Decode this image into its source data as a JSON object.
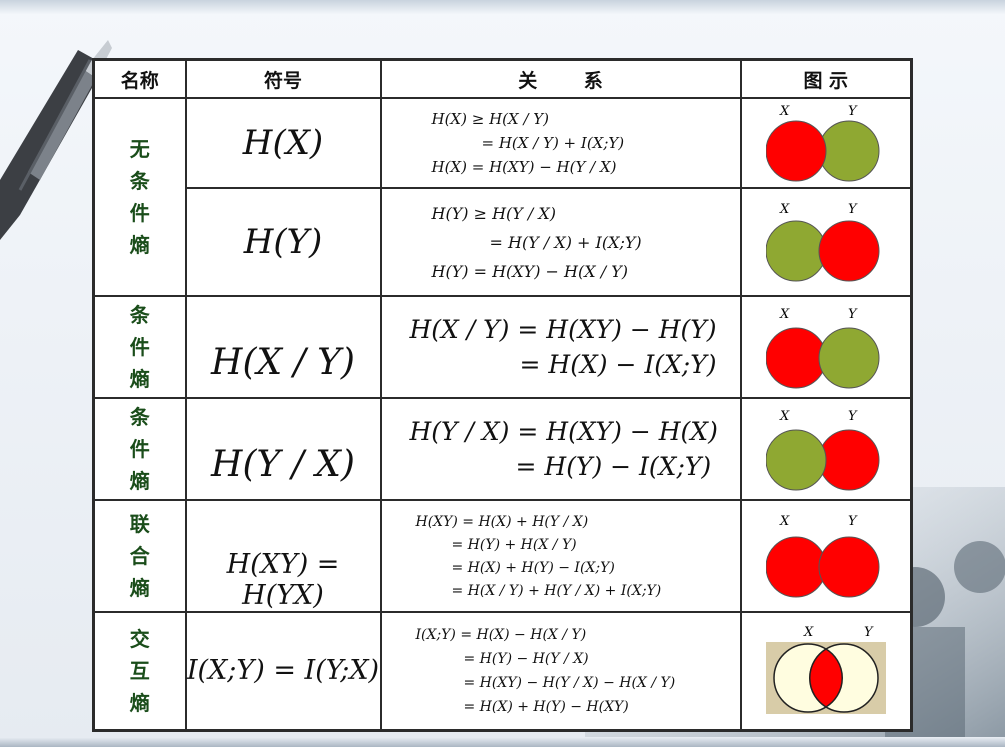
{
  "headers": {
    "name": "名称",
    "symbol": "符号",
    "relation": "关 系",
    "figure": "图 示"
  },
  "venn_labels": {
    "x": "X",
    "y": "Y"
  },
  "colors": {
    "red": "#ff0000",
    "green": "#8fa832",
    "cream": "#fffde0",
    "fig_bg": "#d8cca8",
    "label_green": "#1a4d1a"
  },
  "rows": [
    {
      "name": [
        "无",
        "条",
        "件",
        "熵"
      ],
      "symbol": "H(X)",
      "relation": [
        "H(X) ≥ H(X / Y)",
        "= H(X / Y) + I(X;Y)",
        "H(X) = H(XY) − H(Y / X)"
      ],
      "figure": "venn-x-red"
    },
    {
      "symbol": "H(Y)",
      "relation": [
        "H(Y) ≥ H(Y / X)",
        "= H(Y / X) + I(X;Y)",
        "H(Y) = H(XY) − H(X / Y)"
      ],
      "figure": "venn-y-red"
    },
    {
      "name": [
        "条",
        "件",
        "熵"
      ],
      "symbol": "H(X / Y)",
      "relation": [
        "H(X / Y) = H(XY) − H(Y)",
        "= H(X) − I(X;Y)"
      ],
      "figure": "venn-x-only-red"
    },
    {
      "name": [
        "条",
        "件",
        "熵"
      ],
      "symbol": "H(Y / X)",
      "relation": [
        "H(Y / X) = H(XY) − H(X)",
        "= H(Y) − I(X;Y)"
      ],
      "figure": "venn-y-only-red"
    },
    {
      "name": [
        "联",
        "合",
        "熵"
      ],
      "symbol": "H(XY) = H(YX)",
      "relation": [
        "H(XY) = H(X) + H(Y / X)",
        "= H(Y) + H(X / Y)",
        "= H(X) + H(Y) − I(X;Y)",
        "= H(X / Y) + H(Y / X) + I(X;Y)"
      ],
      "figure": "venn-both-red"
    },
    {
      "name": [
        "交",
        "互",
        "熵"
      ],
      "symbol": "I(X;Y) = I(Y;X)",
      "relation": [
        "I(X;Y) = H(X) − H(X / Y)",
        "= H(Y) − H(Y / X)",
        "= H(XY) − H(Y / X) − H(X / Y)",
        "= H(X) + H(Y) − H(XY)"
      ],
      "figure": "venn-intersection-red"
    }
  ]
}
